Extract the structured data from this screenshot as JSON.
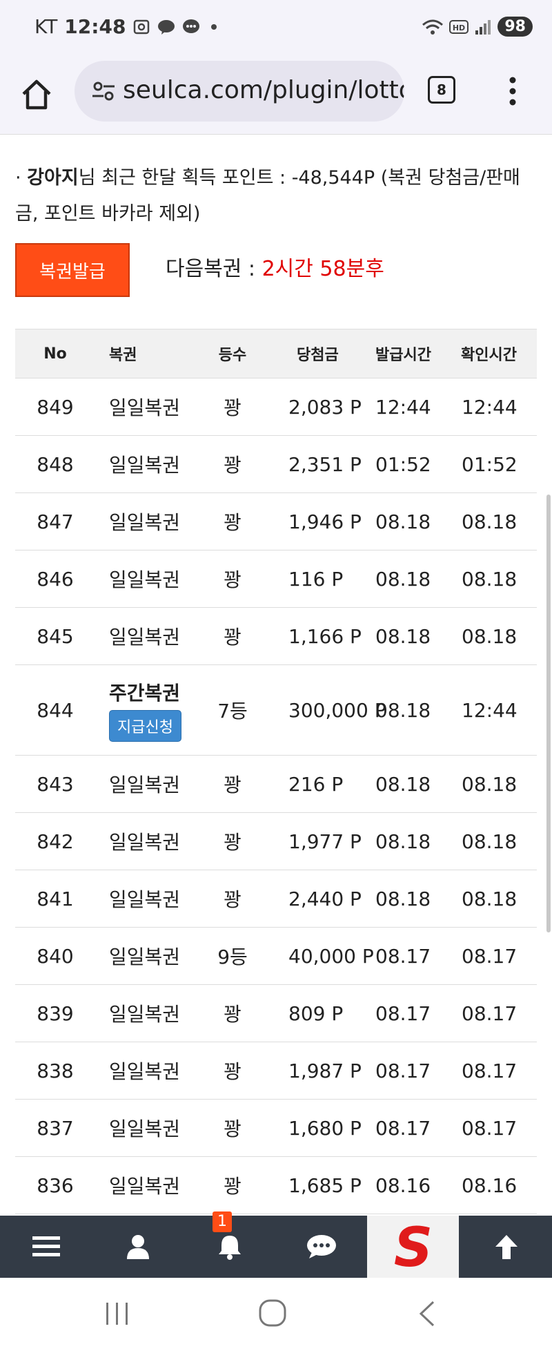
{
  "status": {
    "carrier": "KT",
    "time": "12:48",
    "battery": "98"
  },
  "browser": {
    "url": "seulca.com/plugin/lotto",
    "tab_count": "8"
  },
  "info": {
    "prefix": "· ",
    "username": "강아지",
    "text": "님 최근 한달 획득 포인트 : -48,544P (복권 당첨금/판매금, 포인트 바카라 제외)"
  },
  "issue_button": "복권발급",
  "next": {
    "label": "다음복권 : ",
    "value": "2시간 58분후"
  },
  "table": {
    "headers": [
      "No",
      "복권",
      "등수",
      "당첨금",
      "발급시간",
      "확인시간"
    ],
    "rows": [
      {
        "no": "849",
        "name": "일일복권",
        "rank": "꽝",
        "prize": "2,083 P",
        "issued": "12:44",
        "checked": "12:44"
      },
      {
        "no": "848",
        "name": "일일복권",
        "rank": "꽝",
        "prize": "2,351 P",
        "issued": "01:52",
        "checked": "01:52"
      },
      {
        "no": "847",
        "name": "일일복권",
        "rank": "꽝",
        "prize": "1,946 P",
        "issued": "08.18",
        "checked": "08.18"
      },
      {
        "no": "846",
        "name": "일일복권",
        "rank": "꽝",
        "prize": "116 P",
        "issued": "08.18",
        "checked": "08.18"
      },
      {
        "no": "845",
        "name": "일일복권",
        "rank": "꽝",
        "prize": "1,166 P",
        "issued": "08.18",
        "checked": "08.18"
      },
      {
        "no": "844",
        "name": "주간복권",
        "rank": "7등",
        "prize": "300,000 P",
        "issued": "08.18",
        "checked": "12:44",
        "action": "지급신청"
      },
      {
        "no": "843",
        "name": "일일복권",
        "rank": "꽝",
        "prize": "216 P",
        "issued": "08.18",
        "checked": "08.18"
      },
      {
        "no": "842",
        "name": "일일복권",
        "rank": "꽝",
        "prize": "1,977 P",
        "issued": "08.18",
        "checked": "08.18"
      },
      {
        "no": "841",
        "name": "일일복권",
        "rank": "꽝",
        "prize": "2,440 P",
        "issued": "08.18",
        "checked": "08.18"
      },
      {
        "no": "840",
        "name": "일일복권",
        "rank": "9등",
        "prize": "40,000 P",
        "issued": "08.17",
        "checked": "08.17"
      },
      {
        "no": "839",
        "name": "일일복권",
        "rank": "꽝",
        "prize": "809 P",
        "issued": "08.17",
        "checked": "08.17"
      },
      {
        "no": "838",
        "name": "일일복권",
        "rank": "꽝",
        "prize": "1,987 P",
        "issued": "08.17",
        "checked": "08.17"
      },
      {
        "no": "837",
        "name": "일일복권",
        "rank": "꽝",
        "prize": "1,680 P",
        "issued": "08.17",
        "checked": "08.17"
      },
      {
        "no": "836",
        "name": "일일복권",
        "rank": "꽝",
        "prize": "1,685 P",
        "issued": "08.16",
        "checked": "08.16"
      }
    ]
  },
  "bottom_nav": {
    "notification_count": "1",
    "logo_letter": "S"
  },
  "colors": {
    "accent": "#ff4d16",
    "countdown": "#e00000",
    "pay_button": "#3d8ad0",
    "nav_bg": "#333b46"
  }
}
